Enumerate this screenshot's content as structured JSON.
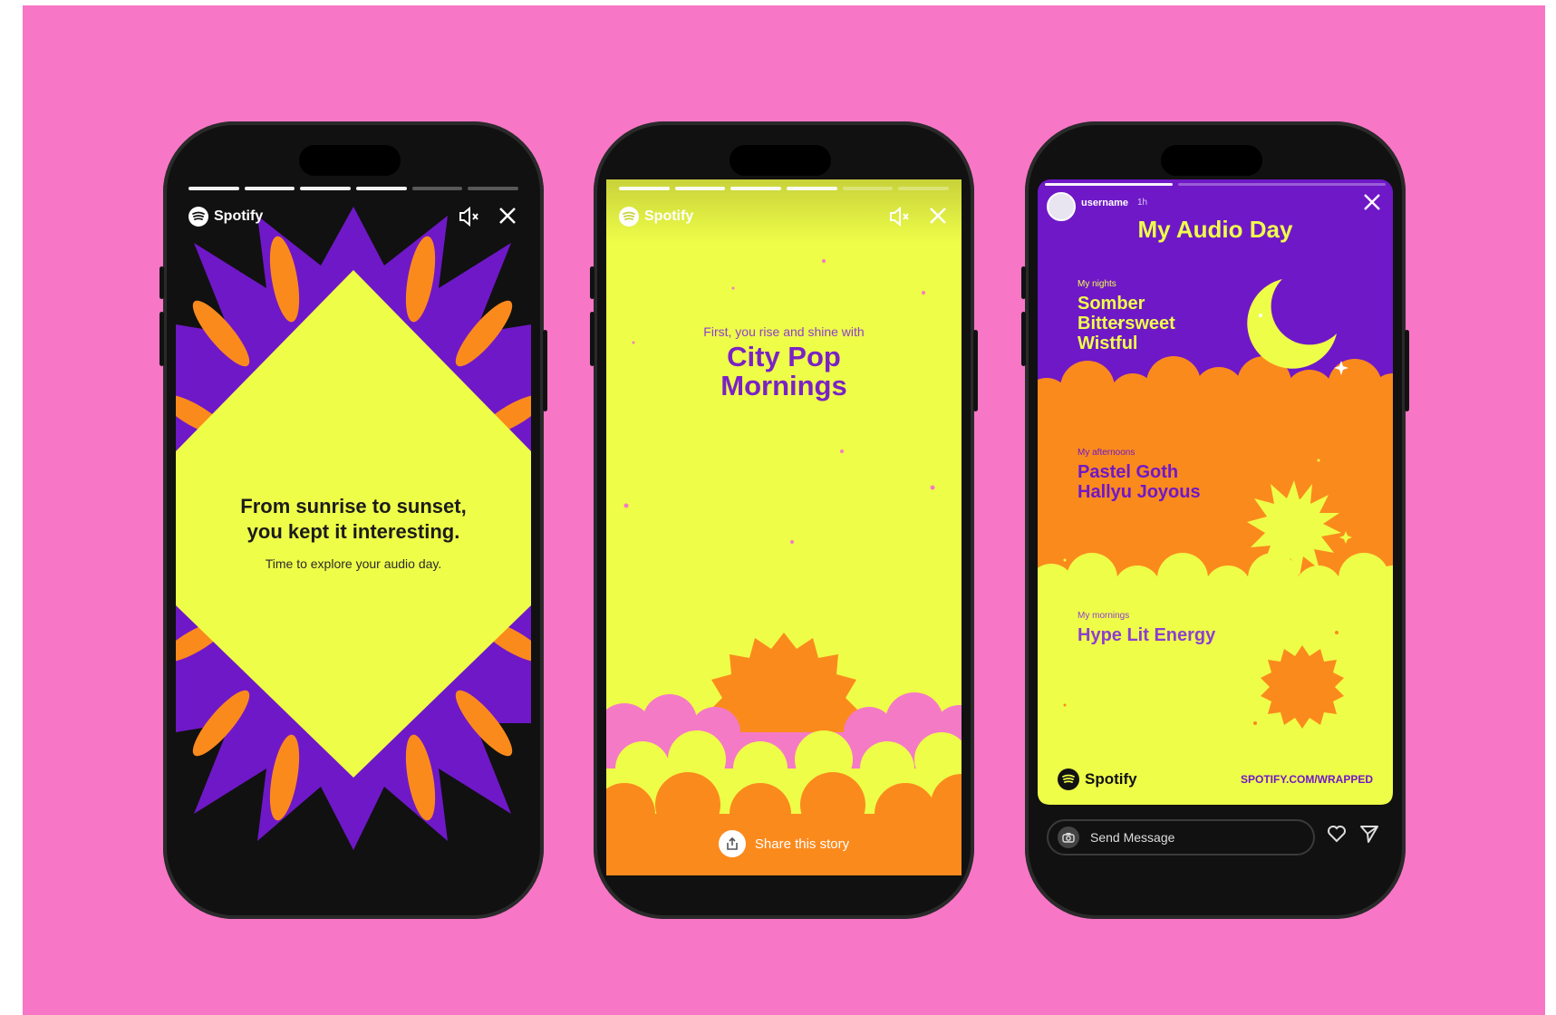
{
  "colors": {
    "backdrop": "#f776c6",
    "yellow": "#eefd48",
    "purple": "#6f18c8",
    "orange": "#fb8a1d",
    "pink": "#f47ac6",
    "black": "#111111"
  },
  "phone1": {
    "progress": {
      "total": 6,
      "filled": 4
    },
    "brand": "Spotify",
    "icons": [
      "mute-icon",
      "close-icon"
    ],
    "headline_line1": "From sunrise to sunset,",
    "headline_line2": "you kept it interesting.",
    "subtext": "Time to explore your audio day."
  },
  "phone2": {
    "progress": {
      "total": 6,
      "filled": 4
    },
    "brand": "Spotify",
    "intro": "First, you rise and shine with",
    "title_line1": "City Pop",
    "title_line2": "Mornings",
    "share_label": "Share this story"
  },
  "phone3": {
    "username": "username",
    "time": "1h",
    "title": "My Audio Day",
    "nights": {
      "label": "My nights",
      "line1": "Somber",
      "line2": "Bittersweet",
      "line3": "Wistful"
    },
    "afternoons": {
      "label": "My afternoons",
      "line1": "Pastel Goth",
      "line2": "Hallyu Joyous"
    },
    "mornings": {
      "label": "My mornings",
      "line1": "Hype Lit Energy"
    },
    "footer_brand": "Spotify",
    "footer_url": "SPOTIFY.COM/WRAPPED",
    "send_placeholder": "Send Message"
  }
}
